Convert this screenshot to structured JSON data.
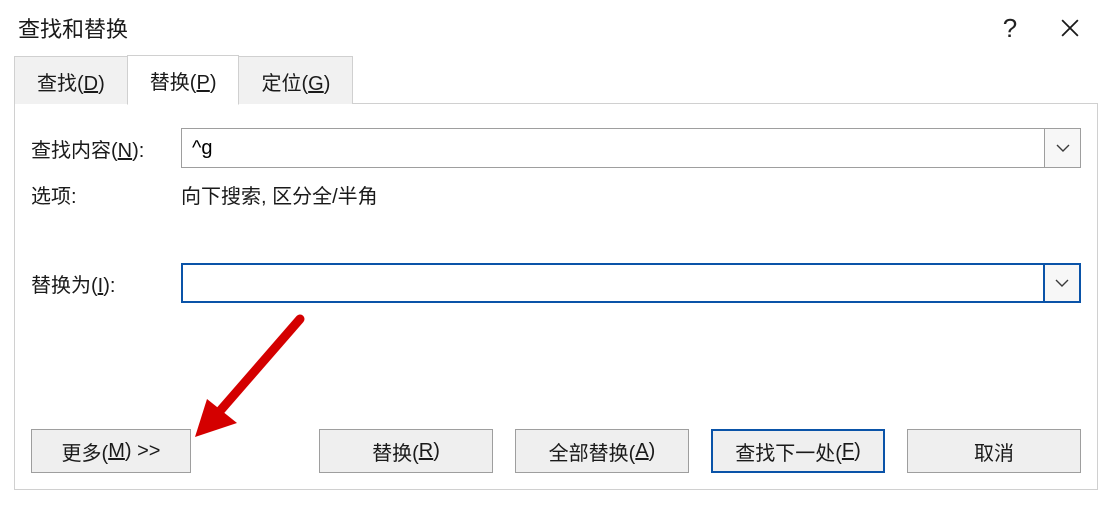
{
  "titlebar": {
    "title": "查找和替换"
  },
  "tabs": {
    "find": {
      "label_pre": "查找(",
      "hotkey": "D",
      "label_post": ")"
    },
    "replace": {
      "label_pre": "替换(",
      "hotkey": "P",
      "label_post": ")"
    },
    "goto": {
      "label_pre": "定位(",
      "hotkey": "G",
      "label_post": ")"
    }
  },
  "form": {
    "find_label_pre": "查找内容(",
    "find_hotkey": "N",
    "find_label_post": "):",
    "find_value": "^g",
    "options_label": "选项:",
    "options_value": "向下搜索, 区分全/半角",
    "replace_label_pre": "替换为(",
    "replace_hotkey": "I",
    "replace_label_post": "):",
    "replace_value": ""
  },
  "buttons": {
    "more_pre": "更多(",
    "more_hotkey": "M",
    "more_post": ") >>",
    "replace_pre": "替换(",
    "replace_hotkey": "R",
    "replace_post": ")",
    "replace_all_pre": "全部替换(",
    "replace_all_hotkey": "A",
    "replace_all_post": ")",
    "find_next_pre": "查找下一处(",
    "find_next_hotkey": "F",
    "find_next_post": ")",
    "cancel": "取消"
  }
}
